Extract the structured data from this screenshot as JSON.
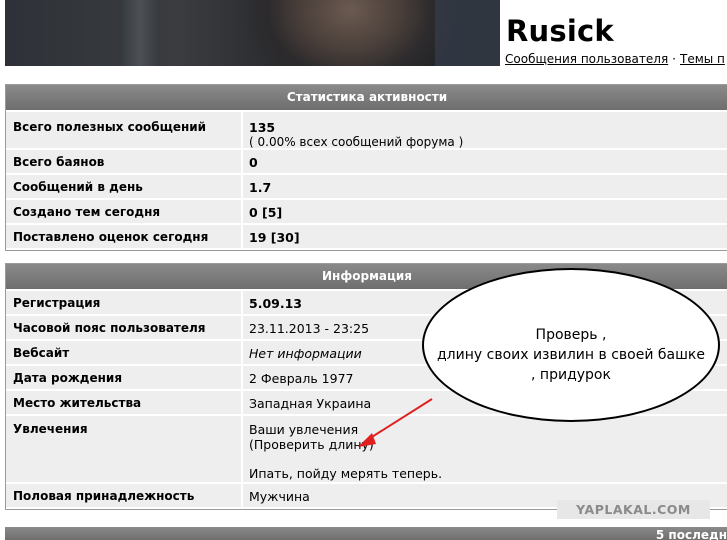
{
  "profile": {
    "username": "Rusick",
    "links": [
      "Сообщения пользователя",
      "Темы п"
    ]
  },
  "stats": {
    "title": "Статистика активности",
    "rows": [
      {
        "label": "Всего полезных сообщений",
        "value": "135",
        "sub": "( 0.00% всех сообщений форума )"
      },
      {
        "label": "Всего баянов",
        "value": "0"
      },
      {
        "label": "Сообщений в день",
        "value": "1.7"
      },
      {
        "label": "Создано тем сегодня",
        "value": "0 [5]"
      },
      {
        "label": "Поставлено оценок сегодня",
        "value": "19 [30]"
      }
    ]
  },
  "info": {
    "title": "Информация",
    "rows": [
      {
        "label": "Регистрация",
        "value": "5.09.13"
      },
      {
        "label": "Часовой пояс пользователя",
        "value": "23.11.2013 - 23:25"
      },
      {
        "label": "Вебсайт",
        "value": "Нет информации"
      },
      {
        "label": "Дата рождения",
        "value": "2 Февраль 1977"
      },
      {
        "label": "Место жительства",
        "value": "Западная Украина"
      },
      {
        "label": "Увлечения",
        "line1": "Ваши увлечения",
        "line2": "(Проверить длину)",
        "line3": "Ипать, пойду мерять теперь."
      },
      {
        "label": "Половая принадлежность",
        "value": "Мужчина"
      }
    ]
  },
  "annotation": {
    "lines": [
      "Проверь ,",
      "длину своих извилин в своей башке",
      ", придурок"
    ],
    "arrow_color": "#e02020"
  },
  "watermark": "YAPLAKAL.COM",
  "next_block_title": "5 последн"
}
